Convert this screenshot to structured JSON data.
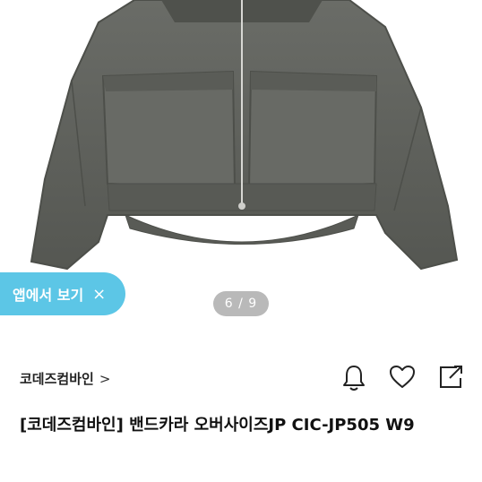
{
  "product_image": {
    "alt": "gray band collar oversized jacket"
  },
  "app_banner": {
    "label": "앱에서 보기",
    "close": "×"
  },
  "gallery": {
    "counter": "6 / 9"
  },
  "shop": {
    "name": "코데즈컴바인",
    "chevron": ">"
  },
  "actions": {
    "icons": [
      "bell-icon",
      "heart-icon",
      "share-icon"
    ]
  },
  "product": {
    "title": "[코데즈컴바인] 밴드카라 오버사이즈JP CIC-JP505 W9"
  },
  "colors": {
    "accent": "#5cc6e6",
    "counter_bg": "#b9b9b9",
    "jacket": "#5e605b"
  }
}
